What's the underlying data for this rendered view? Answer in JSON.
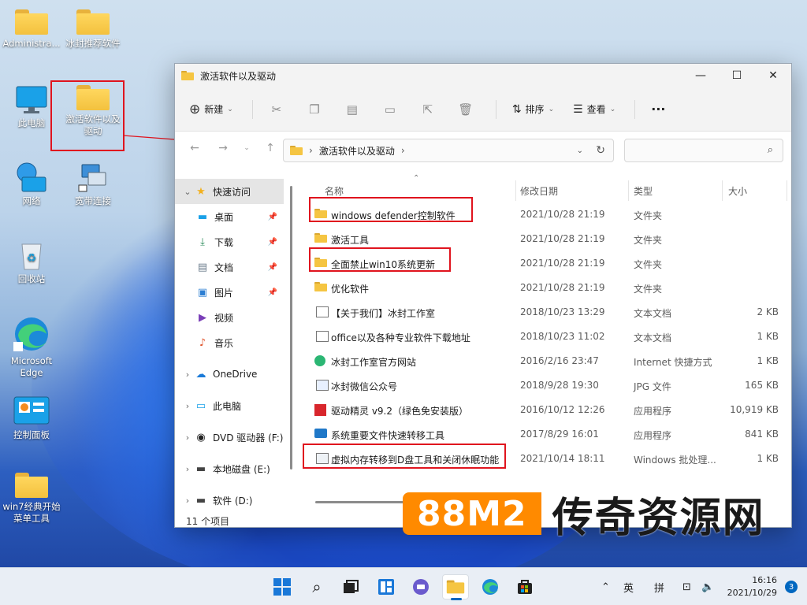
{
  "desktop": {
    "icons": [
      {
        "label": "Administra..."
      },
      {
        "label": "冰封推荐软件"
      },
      {
        "label": "此电脑"
      },
      {
        "label": "激活软件以及驱动"
      },
      {
        "label": "网络"
      },
      {
        "label": "宽带连接"
      },
      {
        "label": "回收站"
      },
      {
        "label": "Microsoft Edge"
      },
      {
        "label": "控制面板"
      },
      {
        "label": "win7经典开始菜单工具"
      }
    ]
  },
  "window": {
    "title": "激活软件以及驱动",
    "toolbar": {
      "new_label": "新建",
      "sort_label": "排序",
      "view_label": "查看",
      "more_label": "···"
    },
    "address": {
      "path": "激活软件以及驱动"
    },
    "sidebar": [
      {
        "label": "快速访问",
        "icon": "star-icon"
      },
      {
        "label": "桌面",
        "icon": "desktop-icon"
      },
      {
        "label": "下载",
        "icon": "download-icon"
      },
      {
        "label": "文档",
        "icon": "document-icon"
      },
      {
        "label": "图片",
        "icon": "picture-icon"
      },
      {
        "label": "视频",
        "icon": "video-icon"
      },
      {
        "label": "音乐",
        "icon": "music-icon"
      },
      {
        "label": "OneDrive",
        "icon": "cloud-icon"
      },
      {
        "label": "此电脑",
        "icon": "computer-icon"
      },
      {
        "label": "DVD 驱动器 (F:)",
        "icon": "dvd-icon"
      },
      {
        "label": "本地磁盘 (E:)",
        "icon": "drive-icon"
      },
      {
        "label": "软件 (D:)",
        "icon": "drive-icon"
      }
    ],
    "columns": {
      "name": "名称",
      "date": "修改日期",
      "type": "类型",
      "size": "大小"
    },
    "files": [
      {
        "name": "windows defender控制软件",
        "date": "2021/10/28 21:19",
        "type": "文件夹",
        "size": ""
      },
      {
        "name": "激活工具",
        "date": "2021/10/28 21:19",
        "type": "文件夹",
        "size": ""
      },
      {
        "name": "全面禁止win10系统更新",
        "date": "2021/10/28 21:19",
        "type": "文件夹",
        "size": ""
      },
      {
        "name": "优化软件",
        "date": "2021/10/28 21:19",
        "type": "文件夹",
        "size": ""
      },
      {
        "name": "【关于我们】冰封工作室",
        "date": "2018/10/23 13:29",
        "type": "文本文档",
        "size": "2 KB"
      },
      {
        "name": "office以及各种专业软件下载地址",
        "date": "2018/10/23 11:02",
        "type": "文本文档",
        "size": "1 KB"
      },
      {
        "name": "冰封工作室官方网站",
        "date": "2016/2/16 23:47",
        "type": "Internet 快捷方式",
        "size": "1 KB"
      },
      {
        "name": "冰封微信公众号",
        "date": "2018/9/28 19:30",
        "type": "JPG 文件",
        "size": "165 KB"
      },
      {
        "name": "驱动精灵 v9.2（绿色免安装版）",
        "date": "2016/10/12 12:26",
        "type": "应用程序",
        "size": "10,919 KB"
      },
      {
        "name": "系统重要文件快速转移工具",
        "date": "2017/8/29 16:01",
        "type": "应用程序",
        "size": "841 KB"
      },
      {
        "name": "虚拟内存转移到D盘工具和关闭休眠功能",
        "date": "2021/10/14 18:11",
        "type": "Windows 批处理...",
        "size": "1 KB"
      }
    ],
    "status": "11 个项目"
  },
  "watermark": {
    "part1": "88M2",
    "part2": "传奇资源网"
  },
  "taskbar": {
    "ime_lang": "英",
    "ime_mode": "拼",
    "time": "16:16",
    "date": "2021/10/29",
    "notifications": "3"
  },
  "colors": {
    "highlight_box": "#e0141e",
    "accent": "#0067c0",
    "folder": "#f5c542"
  }
}
